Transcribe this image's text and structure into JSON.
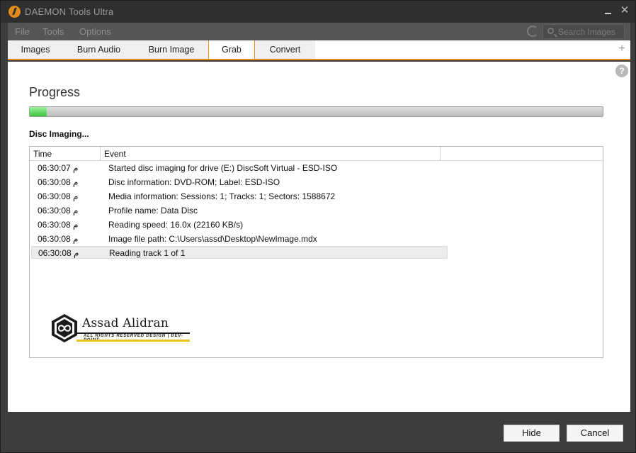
{
  "window": {
    "title": "DAEMON Tools Ultra"
  },
  "menu": {
    "items": [
      "File",
      "Tools",
      "Options"
    ]
  },
  "search": {
    "placeholder": "Search Images"
  },
  "tabs": [
    {
      "label": "Images",
      "active": false
    },
    {
      "label": "Burn Audio",
      "active": false
    },
    {
      "label": "Burn Image",
      "active": false
    },
    {
      "label": "Grab",
      "active": true
    },
    {
      "label": "Convert",
      "active": false
    }
  ],
  "add_tab": "+",
  "help": "?",
  "progress": {
    "title": "Progress",
    "fraction": 0.03,
    "status": "Disc Imaging..."
  },
  "log": {
    "columns": [
      "Time",
      "Event"
    ],
    "rows": [
      {
        "time": "06:30:07 م",
        "event": "Started disc imaging for drive (E:) DiscSoft Virtual - ESD-ISO"
      },
      {
        "time": "06:30:08 م",
        "event": "Disc information: DVD-ROM; Label: ESD-ISO"
      },
      {
        "time": "06:30:08 م",
        "event": "Media information: Sessions: 1; Tracks: 1; Sectors: 1588672"
      },
      {
        "time": "06:30:08 م",
        "event": "Profile name: Data Disc"
      },
      {
        "time": "06:30:08 م",
        "event": "Reading speed: 16.0x (22160 KB/s)"
      },
      {
        "time": "06:30:08 م",
        "event": "Image file path: C:\\Users\\assd\\Desktop\\NewImage.mdx"
      },
      {
        "time": "06:30:08 م",
        "event": "Reading track 1 of 1",
        "selected": true
      }
    ]
  },
  "watermark": {
    "name": "Assad Alidran",
    "subtitle": "ALL RIGHTS RESERVED DESIGN | DEV-POINT"
  },
  "buttons": {
    "hide": "Hide",
    "cancel": "Cancel"
  },
  "colors": {
    "accent": "#e88a1a",
    "progress": "#3cc43c",
    "chrome": "#3c3c3c"
  }
}
